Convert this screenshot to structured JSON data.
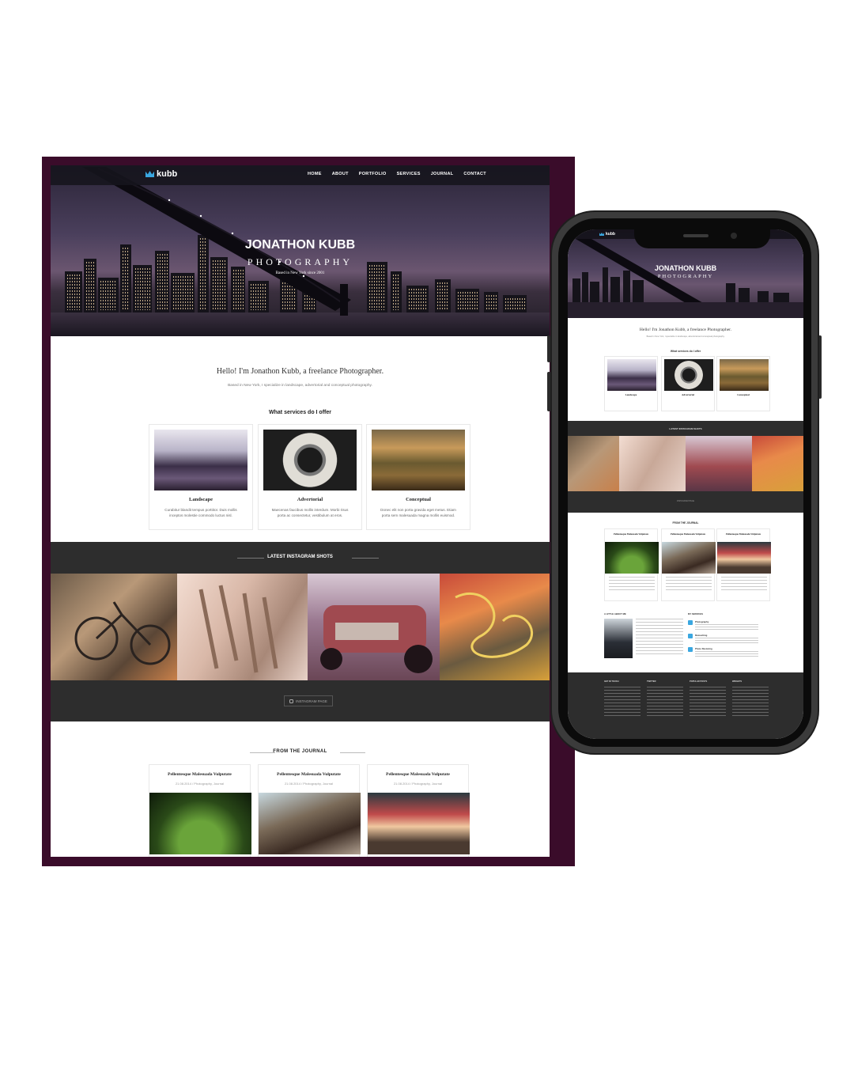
{
  "brand": {
    "logo_text": "kubb",
    "accent": "#3aa7e0",
    "frame_color": "#3a0c2a"
  },
  "nav": {
    "items": [
      "HOME",
      "ABOUT",
      "PORTFOLIO",
      "SERVICES",
      "JOURNAL",
      "CONTACT"
    ]
  },
  "hero": {
    "name": "JONATHON KUBB",
    "subtitle": "PHOTOGRAPHY",
    "tagline": "Based in New York since 2001"
  },
  "intro": {
    "heading": "Hello! I'm Jonathon Kubb, a freelance Photographer.",
    "text": "Based in New York, I specialize in landscape, advertorial and conceptual photography."
  },
  "services": {
    "title": "What services do I offer",
    "items": [
      {
        "name": "Landscape",
        "text": "Curabitur blandit tempus porttitor. Duis mollis inceptos molestie commodo luctus nisl."
      },
      {
        "name": "Advertorial",
        "text": "Maecenas faucibus mollis interdum. Morbi risus porta ac consectetur, vestibulum at eros."
      },
      {
        "name": "Conceptual",
        "text": "Donec elit non porta gravida eget metus. Etiam porta sem malesuada magna mollis euismod."
      }
    ]
  },
  "instagram": {
    "title": "LATEST INSTAGRAM SHOTS",
    "button": "INSTAGRAM PAGE",
    "icon": "instagram-icon"
  },
  "journal": {
    "title": "FROM THE JOURNAL",
    "posts": [
      {
        "title": "Pellentesque Malesuada Vulputate",
        "meta": "21.08.2014 / Photography, Journal",
        "excerpt": "Curabitur blandit tempus porttitor. Duis at vallubs"
      },
      {
        "title": "Pellentesque Malesuada Vulputate",
        "meta": "21.08.2014 / Photography, Journal",
        "excerpt": "Curabitur blandit tempus porttitor. Duis at vallubs"
      },
      {
        "title": "Pellentesque Malesuada Vulputate",
        "meta": "21.08.2014 / Photography, Journal",
        "excerpt": "Curabitur blandit tempus porttitor. Duis at vallubs"
      }
    ]
  },
  "mobile": {
    "nav_label": "CONTACT",
    "about_title": "A LITTLE ABOUT ME",
    "my_services_title": "MY SERVICES",
    "my_services": [
      "Photography",
      "Retouching",
      "Photo Restoring"
    ],
    "footer_columns": [
      "GET IN TOUCH",
      "TWITTER",
      "POPULAR POSTS",
      "WIDGETS"
    ]
  }
}
